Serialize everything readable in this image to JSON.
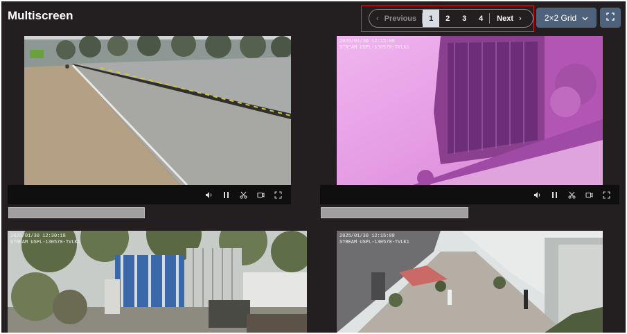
{
  "header": {
    "title": "Multiscreen"
  },
  "pagination": {
    "previous_label": "Previous",
    "next_label": "Next",
    "pages": [
      "1",
      "2",
      "3",
      "4"
    ],
    "active_page": "1"
  },
  "layout_select": {
    "label": "2×2 Grid"
  },
  "colors": {
    "background": "#231f20",
    "accent_button": "#4f627b",
    "highlight_outline": "#d62b2b",
    "active_page": "#d9dde3"
  },
  "cameras": [
    {
      "osd_lines": []
    },
    {
      "osd_lines": [
        "2025/01/30 12:15:08",
        "STREAM USPL-130570-TVLK1"
      ]
    },
    {
      "osd_lines": [
        "2025/01/30 12:30:18",
        "STREAM USPL-130570-TVLK1"
      ]
    },
    {
      "osd_lines": [
        "2025/01/30 12:15:08",
        "STREAM USPL-130570-TVLK1"
      ]
    }
  ],
  "icons": [
    "volume-icon",
    "pause-icon",
    "scissors-icon",
    "record-icon",
    "expand-icon",
    "chevron-left-icon",
    "chevron-right-icon",
    "chevron-down-icon",
    "fullscreen-icon"
  ]
}
